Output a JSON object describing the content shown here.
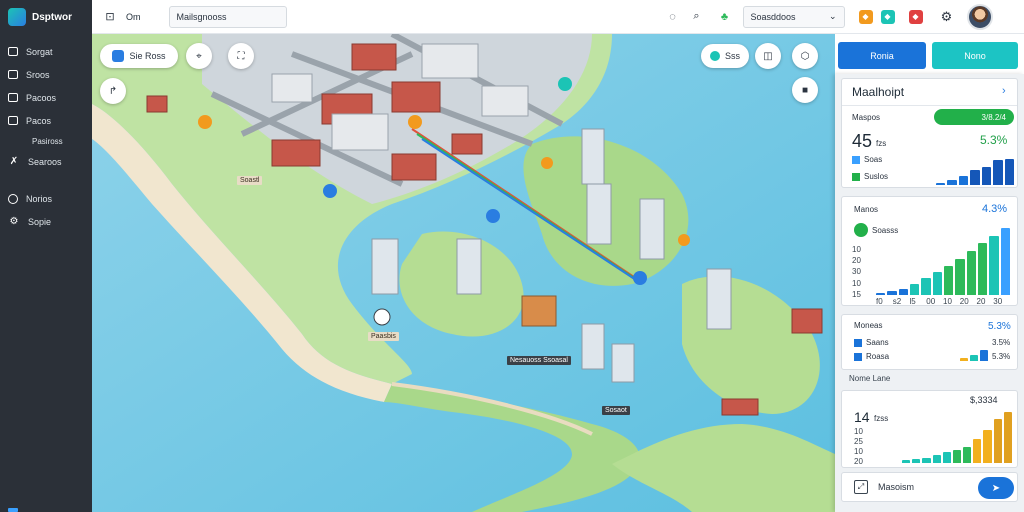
{
  "app": {
    "brand": "Dsptwor"
  },
  "sidebar": {
    "items": [
      {
        "label": "Sorgat",
        "icon": "layers-icon"
      },
      {
        "label": "Sroos",
        "icon": "folder-icon"
      },
      {
        "label": "Pacoos",
        "icon": "dashboard-icon"
      },
      {
        "label": "Pacos",
        "icon": "box-icon"
      },
      {
        "label": "Pasiross",
        "icon": "",
        "sub": true
      },
      {
        "label": "Searoos",
        "icon": "route-icon"
      },
      {
        "label": "",
        "icon": "bar-icon"
      },
      {
        "label": "Norios",
        "icon": "circle-icon"
      },
      {
        "label": "Sopie",
        "icon": "settings-icon"
      }
    ]
  },
  "topbar": {
    "menu_label": "Om",
    "search_value": "Mailsgnooss",
    "filter_value": "Soasddoos",
    "colors": {
      "orange": "#f29a1e",
      "teal": "#1cc4b5",
      "red": "#e04040",
      "green": "#2dba5a"
    }
  },
  "map": {
    "layer_pill": "Sie  Ross",
    "zoom_pill": "Sss",
    "labels": [
      "Soastl",
      "Paasbis",
      "Nesauoss Ssoasal",
      "Sosaot"
    ]
  },
  "buttons": {
    "primary": "Ronia",
    "secondary": "Nono"
  },
  "panel": {
    "title": "Maalhoipt",
    "card1": {
      "label": "Maspos",
      "progress_label": "3/8.2/4",
      "value": "45",
      "unit": "fzs",
      "percent": "5.3%",
      "legend": [
        "Soas",
        "Suslos"
      ],
      "bars": [
        0.05,
        0.1,
        0.18,
        0.32,
        0.38,
        0.52,
        0.55
      ]
    },
    "card2": {
      "label": "Manos",
      "percent": "4.3%",
      "sub_label": "Soasss",
      "y_ticks": [
        "10",
        "20",
        "30",
        "10",
        "15"
      ],
      "x_ticks": [
        "f0",
        "s2",
        "l5",
        "00",
        "10",
        "20",
        "20",
        "30"
      ],
      "bars": [
        {
          "value": 0.02,
          "color": "#1a73d9"
        },
        {
          "value": 0.05,
          "color": "#1a73d9"
        },
        {
          "value": 0.08,
          "color": "#1a73d9"
        },
        {
          "value": 0.14,
          "color": "#1cc4b5"
        },
        {
          "value": 0.22,
          "color": "#1cc4b5"
        },
        {
          "value": 0.3,
          "color": "#1cc4b5"
        },
        {
          "value": 0.38,
          "color": "#2dba5a"
        },
        {
          "value": 0.48,
          "color": "#2dba5a"
        },
        {
          "value": 0.58,
          "color": "#2dba5a"
        },
        {
          "value": 0.68,
          "color": "#2dba5a"
        },
        {
          "value": 0.78,
          "color": "#1cc4b5"
        },
        {
          "value": 0.88,
          "color": "#3aa0ff"
        }
      ]
    },
    "card3": {
      "label": "Moneas",
      "percent": "5.3%",
      "legend": [
        "Saans",
        "Roasa"
      ],
      "values": [
        "3.5%",
        "5.3%"
      ],
      "bars": [
        0.2,
        0.4,
        0.7
      ]
    },
    "section_label": "Nome Lane",
    "card4": {
      "value": "14",
      "unit": "fzss",
      "top_value": "$,3334",
      "y_ticks": [
        "10",
        "25",
        "10",
        "20"
      ],
      "bars": [
        0.05,
        0.08,
        0.1,
        0.14,
        0.2,
        0.24,
        0.3,
        0.45,
        0.62,
        0.82,
        0.95
      ]
    },
    "footer_label": "Masoism"
  }
}
